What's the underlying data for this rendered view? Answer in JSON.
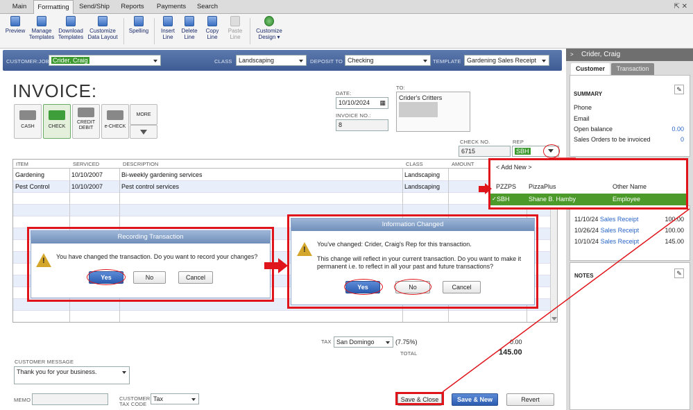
{
  "menubar": {
    "tabs": [
      "Main",
      "Formatting",
      "Send/Ship",
      "Reports",
      "Payments",
      "Search"
    ],
    "active": "Formatting",
    "window_controls": "⇱ ✕"
  },
  "ribbon": {
    "buttons": [
      {
        "label": "Preview",
        "icon": "preview-icon"
      },
      {
        "label": "Manage\nTemplates",
        "icon": "templates-icon"
      },
      {
        "label": "Download\nTemplates",
        "icon": "download-icon"
      },
      {
        "label": "Customize\nData Layout",
        "icon": "layout-icon"
      },
      {
        "label": "Spelling",
        "icon": "spelling-icon"
      },
      {
        "label": "Insert\nLine",
        "icon": "insert-line-icon"
      },
      {
        "label": "Delete\nLine",
        "icon": "delete-line-icon"
      },
      {
        "label": "Copy\nLine",
        "icon": "copy-line-icon"
      },
      {
        "label": "Paste\nLine",
        "icon": "paste-line-icon"
      },
      {
        "label": "Customize\nDesign ▾",
        "icon": "customize-design-icon"
      }
    ]
  },
  "customer_bar": {
    "customer_job_label": "CUSTOMER:JOB",
    "customer_job": "Crider, Craig",
    "class_label": "CLASS",
    "class": "Landscaping",
    "deposit_label": "DEPOSIT TO",
    "deposit": "Checking",
    "template_label": "TEMPLATE",
    "template": "Gardening Sales Receipt"
  },
  "invoice": {
    "title": "INVOICE:",
    "date_label": "DATE:",
    "date": "10/10/2024",
    "invoice_no_label": "INVOICE NO.:",
    "invoice_no": "8",
    "to_label": "TO:",
    "to": "Crider's Critters",
    "check_no_label": "CHECK NO.",
    "check_no": "6715",
    "rep_label": "REP",
    "rep": "SBH",
    "payment_methods": [
      "CASH",
      "CHECK",
      "CREDIT\nDEBIT",
      "e-CHECK"
    ],
    "more_label": "MORE",
    "columns": [
      "ITEM",
      "SERVICED",
      "DESCRIPTION",
      "CLASS",
      "AMOUNT"
    ],
    "rows": [
      {
        "item": "Gardening",
        "serviced": "10/10/2007",
        "description": "Bi-weekly gardening services",
        "class": "Landscaping"
      },
      {
        "item": "Pest Control",
        "serviced": "10/10/2007",
        "description": "Pest control services",
        "class": "Landscaping"
      }
    ],
    "tax_label": "TAX",
    "tax": "San Domingo",
    "tax_rate": "(7.75%)",
    "tax_amount": "0.00",
    "total_label": "TOTAL",
    "total": "145.00",
    "customer_message_label": "CUSTOMER MESSAGE",
    "customer_message": "Thank you for your business.",
    "memo_label": "MEMO",
    "customer_tax_code_label": "CUSTOMER\nTAX CODE",
    "customer_tax_code": "Tax",
    "save_close": "Save & Close",
    "save_new": "Save & New",
    "revert": "Revert"
  },
  "rep_dropdown": {
    "add_new": "< Add New >",
    "rows": [
      {
        "code": "PZZPS",
        "name": "PizzaPlus",
        "type": "Other Name"
      },
      {
        "code": "SBH",
        "name": "Shane B. Hamby",
        "type": "Employee"
      }
    ]
  },
  "dialog_recording": {
    "title": "Recording Transaction",
    "message": "You have changed the transaction. Do you want to record your changes?",
    "yes": "Yes",
    "no": "No",
    "cancel": "Cancel"
  },
  "dialog_info": {
    "title": "Information Changed",
    "line1": "You've changed: Crider, Craig's Rep for this transaction.",
    "line2": "This change will reflect in your current transaction. Do you want to make it permanent i.e. to reflect in all your past and future transactions?",
    "yes": "Yes",
    "no": "No",
    "cancel": "Cancel"
  },
  "side_panel": {
    "title": "Crider, Craig",
    "tabs": [
      "Customer",
      "Transaction"
    ],
    "summary_label": "SUMMARY",
    "summary_rows": [
      {
        "label": "Phone",
        "value": ""
      },
      {
        "label": "Email",
        "value": ""
      },
      {
        "label": "Open balance",
        "value": "0.00"
      },
      {
        "label": "Sales Orders to be invoiced",
        "value": "0"
      }
    ],
    "recent": [
      {
        "date": "11/10/24",
        "type": "Sales Receipt",
        "amount": "100.00"
      },
      {
        "date": "10/26/24",
        "type": "Sales Receipt",
        "amount": "100.00"
      },
      {
        "date": "10/10/24",
        "type": "Sales Receipt",
        "amount": "145.00"
      }
    ],
    "notes_label": "NOTES"
  }
}
